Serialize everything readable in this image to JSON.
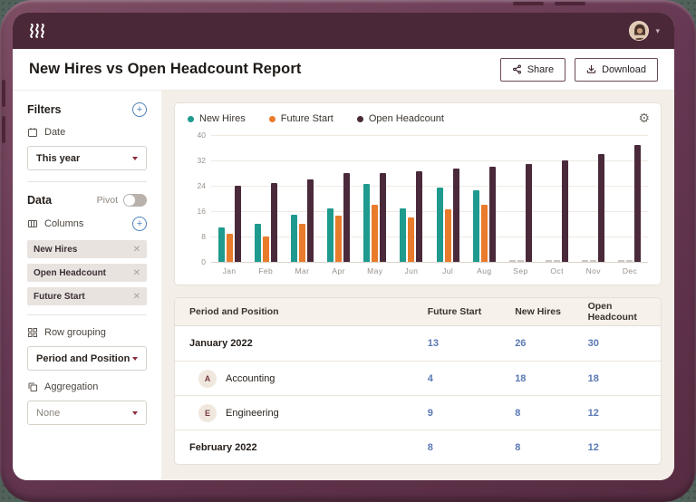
{
  "header": {
    "title": "New Hires vs Open Headcount Report",
    "share_label": "Share",
    "download_label": "Download"
  },
  "sidebar": {
    "filters_title": "Filters",
    "date_label": "Date",
    "date_value": "This year",
    "data_title": "Data",
    "pivot_label": "Pivot",
    "columns_label": "Columns",
    "column_tags": [
      "New Hires",
      "Open Headcount",
      "Future Start"
    ],
    "row_grouping_label": "Row grouping",
    "row_grouping_value": "Period and Position",
    "aggregation_label": "Aggregation",
    "aggregation_value": "None"
  },
  "chart_data": {
    "type": "bar",
    "categories": [
      "Jan",
      "Feb",
      "Mar",
      "Apr",
      "May",
      "Jun",
      "Jul",
      "Aug",
      "Sep",
      "Oct",
      "Nov",
      "Dec"
    ],
    "series": [
      {
        "name": "New Hires",
        "color": "#1f9a8e",
        "values": [
          11,
          12,
          15,
          17,
          24.5,
          17,
          23.5,
          22.5,
          0,
          0,
          0,
          0
        ]
      },
      {
        "name": "Future Start",
        "color": "#e97b2c",
        "values": [
          9,
          8,
          12,
          14.5,
          18,
          14,
          16.5,
          18,
          0,
          0,
          0,
          0
        ]
      },
      {
        "name": "Open Headcount",
        "color": "#4a2a3a",
        "values": [
          24,
          25,
          26,
          28,
          28,
          28.5,
          29.5,
          30,
          31,
          32,
          34,
          37
        ]
      }
    ],
    "ylim": [
      0,
      40
    ],
    "yticks": [
      40,
      32,
      24,
      16,
      8,
      0
    ],
    "grid": true,
    "legend_position": "top"
  },
  "table": {
    "link_color": "#5a78b4",
    "columns": [
      "Period and Position",
      "Future Start",
      "New Hires",
      "Open Headcount"
    ],
    "rows": [
      {
        "type": "group",
        "label": "January 2022",
        "future_start": "13",
        "new_hires": "26",
        "open_headcount": "30"
      },
      {
        "type": "child",
        "initial": "A",
        "label": "Accounting",
        "future_start": "4",
        "new_hires": "18",
        "open_headcount": "18"
      },
      {
        "type": "child",
        "initial": "E",
        "label": "Engineering",
        "future_start": "9",
        "new_hires": "8",
        "open_headcount": "12"
      },
      {
        "type": "group",
        "label": "February 2022",
        "future_start": "8",
        "new_hires": "8",
        "open_headcount": "12"
      }
    ]
  }
}
